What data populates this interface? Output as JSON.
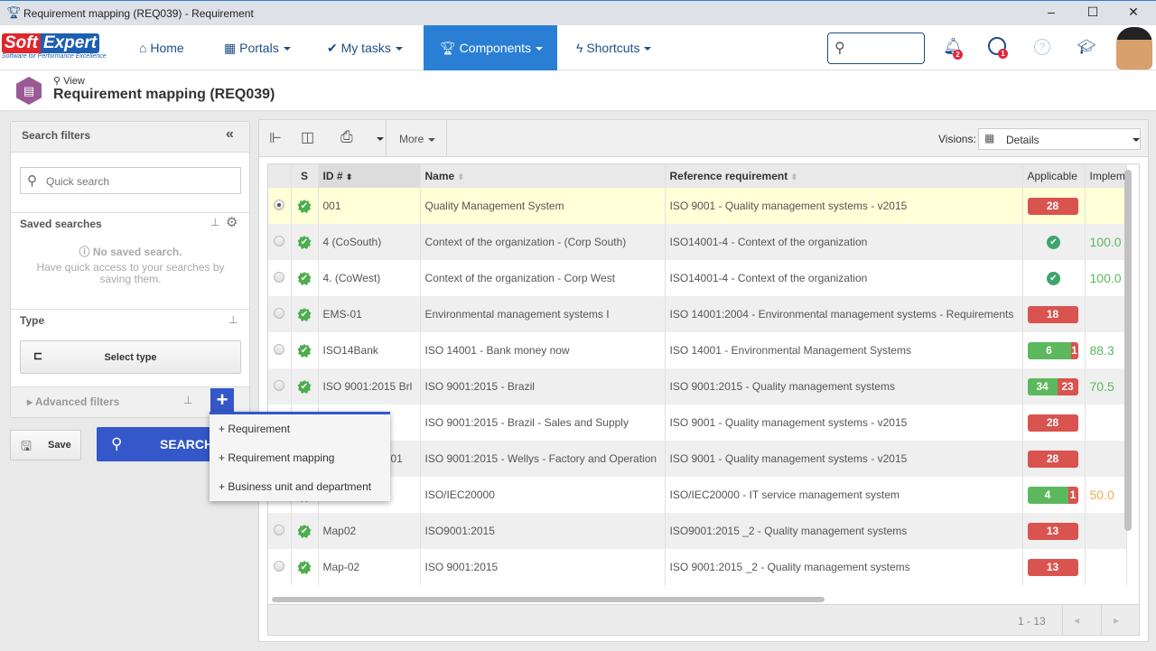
{
  "window": {
    "title": "Requirement mapping (REQ039) - Requirement",
    "minimize": "–",
    "maximize": "☐",
    "close": "✕"
  },
  "nav": {
    "logo": "SoftExpert",
    "logo_tagline": "Software for Performance Excellence",
    "items": [
      {
        "label": "Home",
        "icon": "home-icon"
      },
      {
        "label": "Portals",
        "icon": "grid-icon"
      },
      {
        "label": "My tasks",
        "icon": "check-icon"
      },
      {
        "label": "Components",
        "icon": "trophy-icon",
        "active": true
      },
      {
        "label": "Shortcuts",
        "icon": "bolt-icon"
      }
    ],
    "notifications_count": "2",
    "tasks_count": "1",
    "accent": "#2a7fd4"
  },
  "page": {
    "mode": "View",
    "title": "Requirement mapping (REQ039)"
  },
  "filters": {
    "title": "Search filters",
    "quick_search_placeholder": "Quick search",
    "saved_title": "Saved searches",
    "no_saved": "No saved search.",
    "no_saved_hint": "Have quick access to your searches by saving them.",
    "type_title": "Type",
    "select_type": "Select type",
    "advanced": "Advanced filters",
    "save": "Save",
    "search": "SEARCH"
  },
  "add_menu": {
    "items": [
      "Requirement",
      "Requirement mapping",
      "Business unit and department"
    ]
  },
  "toolbar": {
    "more": "More",
    "visions_label": "Visions:",
    "vision": "Details"
  },
  "grid": {
    "columns": [
      "S",
      "ID #",
      "Name",
      "Reference requirement",
      "Applicable",
      "Implem"
    ],
    "rows": [
      {
        "id": "001",
        "name": "Quality Management System",
        "ref": "ISO 9001 - Quality management systems - v2015",
        "green": 0,
        "red": 28,
        "impl": "",
        "selected": true
      },
      {
        "id": "4 (CoSouth)",
        "name": "Context of the organization - (Corp South)",
        "ref": "ISO14001-4 - Context of the organization",
        "check": true,
        "impl": "100.0",
        "impl_color": "#5cb85c"
      },
      {
        "id": "4. (CoWest)",
        "name": "Context of the organization - Corp West",
        "ref": "ISO14001-4 - Context of the organization",
        "check": true,
        "impl": "100.0",
        "impl_color": "#5cb85c"
      },
      {
        "id": "EMS-01",
        "name": "Environmental management systems I",
        "ref": "ISO 14001:2004 - Environmental management systems - Requirements",
        "green": 0,
        "red": 18,
        "impl": ""
      },
      {
        "id": "ISO14Bank",
        "name": "ISO 14001 - Bank money now",
        "ref": "ISO 14001 - Environmental Management Systems",
        "green": 6,
        "red": 1,
        "impl": "88.3",
        "impl_color": "#5cb85c"
      },
      {
        "id": "ISO 9001:2015 Brl",
        "name": "ISO 9001:2015 - Brazil",
        "ref": "ISO 9001:2015 - Quality management systems",
        "green": 34,
        "red": 23,
        "impl": "70.5",
        "impl_color": "#5cb85c"
      },
      {
        "id": "",
        "name": "ISO 9001:2015 - Brazil - Sales and Supply",
        "ref": "ISO 9001 - Quality management systems - v2015",
        "green": 0,
        "red": 28,
        "impl": ""
      },
      {
        "id": "01",
        "name": "ISO 9001:2015 - Wellys - Factory and Operation",
        "ref": "ISO 9001 - Quality management systems - v2015",
        "green": 0,
        "red": 28,
        "impl": ""
      },
      {
        "id": "",
        "name": "ISO/IEC20000",
        "ref": "ISO/IEC20000 - IT service management system",
        "green": 4,
        "red": 1,
        "impl": "50.0",
        "impl_color": "#f0ad4e"
      },
      {
        "id": "Map02",
        "name": "ISO9001:2015",
        "ref": "ISO9001:2015 _2 - Quality management systems",
        "green": 0,
        "red": 13,
        "impl": ""
      },
      {
        "id": "Map-02",
        "name": "ISO 9001:2015",
        "ref": "ISO 9001:2015 _2 - Quality management systems",
        "green": 0,
        "red": 13,
        "impl": ""
      }
    ],
    "pager": "1 - 13"
  }
}
